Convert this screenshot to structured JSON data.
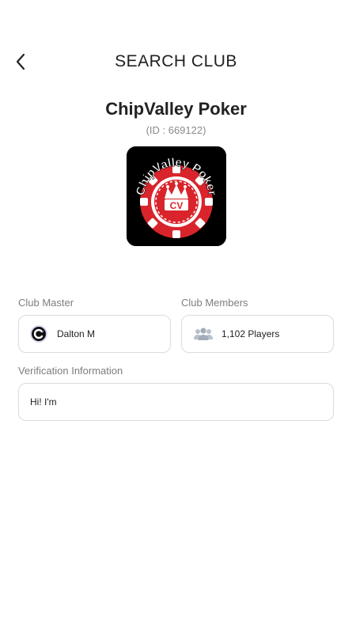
{
  "header": {
    "title": "SEARCH CLUB",
    "back_icon": "chevron-left-icon"
  },
  "club": {
    "name": "ChipValley Poker",
    "id_text": "(ID : 669122)",
    "logo": {
      "ring_text": "ChipValley Poker",
      "center_text": "CV",
      "colors": {
        "background": "#000000",
        "chip_red": "#d9242b",
        "chip_white": "#ffffff"
      }
    }
  },
  "master": {
    "label": "Club Master",
    "name": "Dalton M",
    "avatar_icon": "c-logo-avatar-icon"
  },
  "members": {
    "label": "Club Members",
    "count_text": "1,102 Players",
    "icon": "users-icon"
  },
  "verification": {
    "label": "Verification Information",
    "value": "Hi! I'm"
  }
}
